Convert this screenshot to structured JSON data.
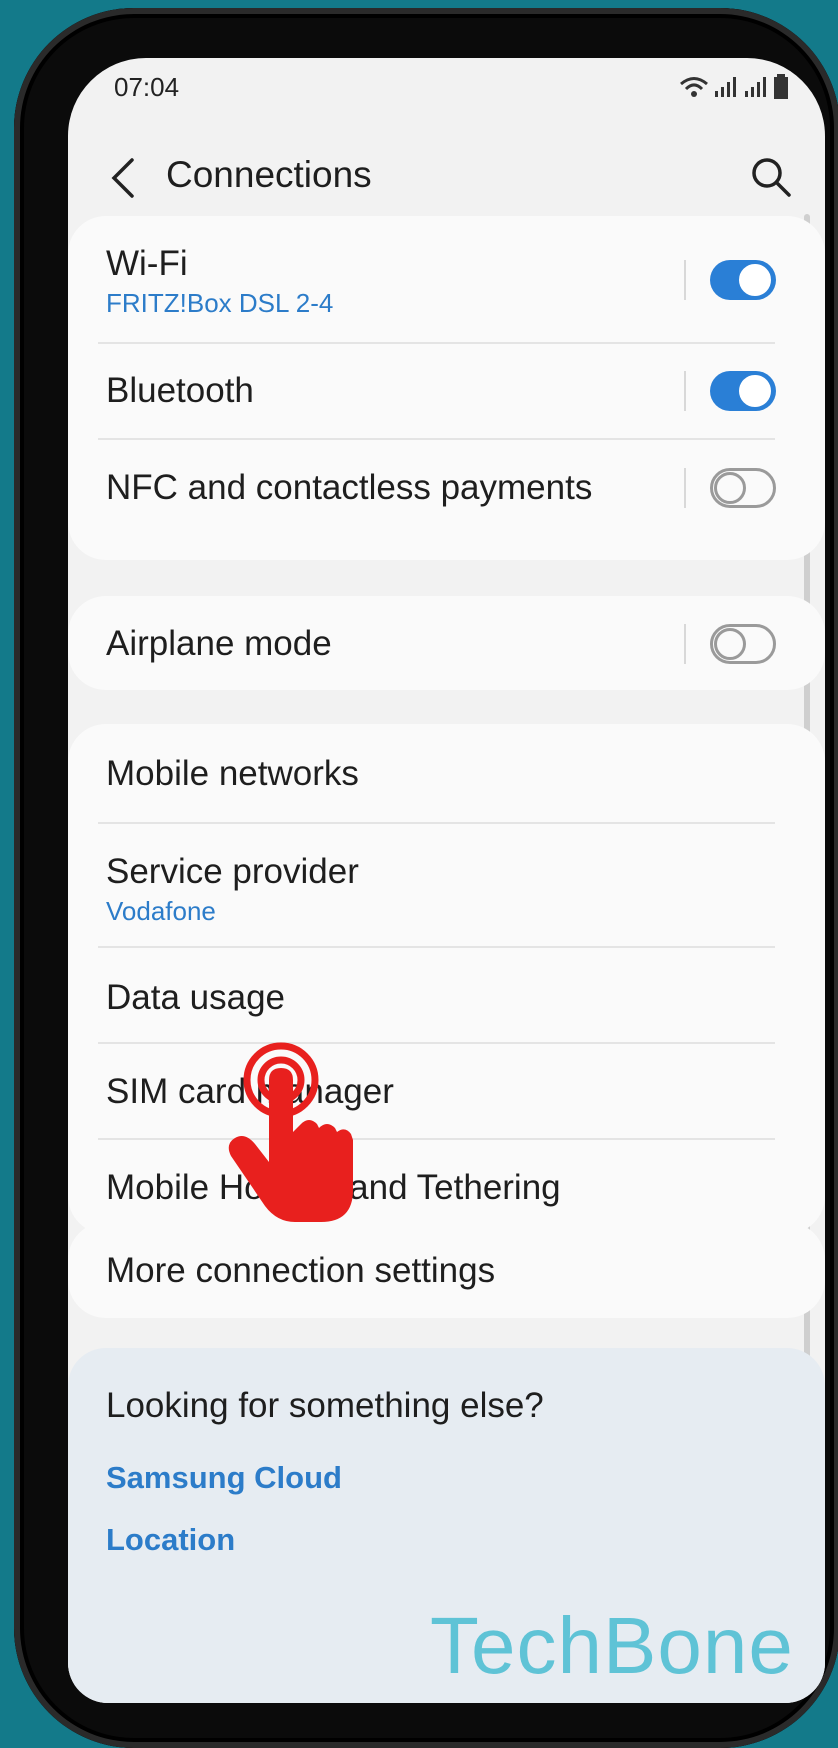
{
  "status_bar": {
    "time": "07:04"
  },
  "header": {
    "title": "Connections"
  },
  "group1": {
    "wifi": {
      "label": "Wi-Fi",
      "sub": "FRITZ!Box DSL 2-4",
      "toggle": "on"
    },
    "bluetooth": {
      "label": "Bluetooth",
      "toggle": "on"
    },
    "nfc": {
      "label": "NFC and contactless payments",
      "toggle": "off"
    }
  },
  "group2": {
    "airplane": {
      "label": "Airplane mode",
      "toggle": "off"
    }
  },
  "group3": {
    "mobile_networks": {
      "label": "Mobile networks"
    },
    "service_provider": {
      "label": "Service provider",
      "sub": "Vodafone"
    },
    "data_usage": {
      "label": "Data usage"
    },
    "sim_card_manager": {
      "label": "SIM card manager"
    },
    "hotspot": {
      "label": "Mobile Hotspot and Tethering"
    }
  },
  "group4": {
    "more": {
      "label": "More connection settings"
    }
  },
  "footer": {
    "title": "Looking for something else?",
    "links": [
      "Samsung Cloud",
      "Location"
    ]
  },
  "watermark": "TechBone",
  "colors": {
    "accent": "#2a7fd6",
    "link": "#2c7cc9",
    "background": "#137a8a",
    "hand": "#e8201e"
  }
}
